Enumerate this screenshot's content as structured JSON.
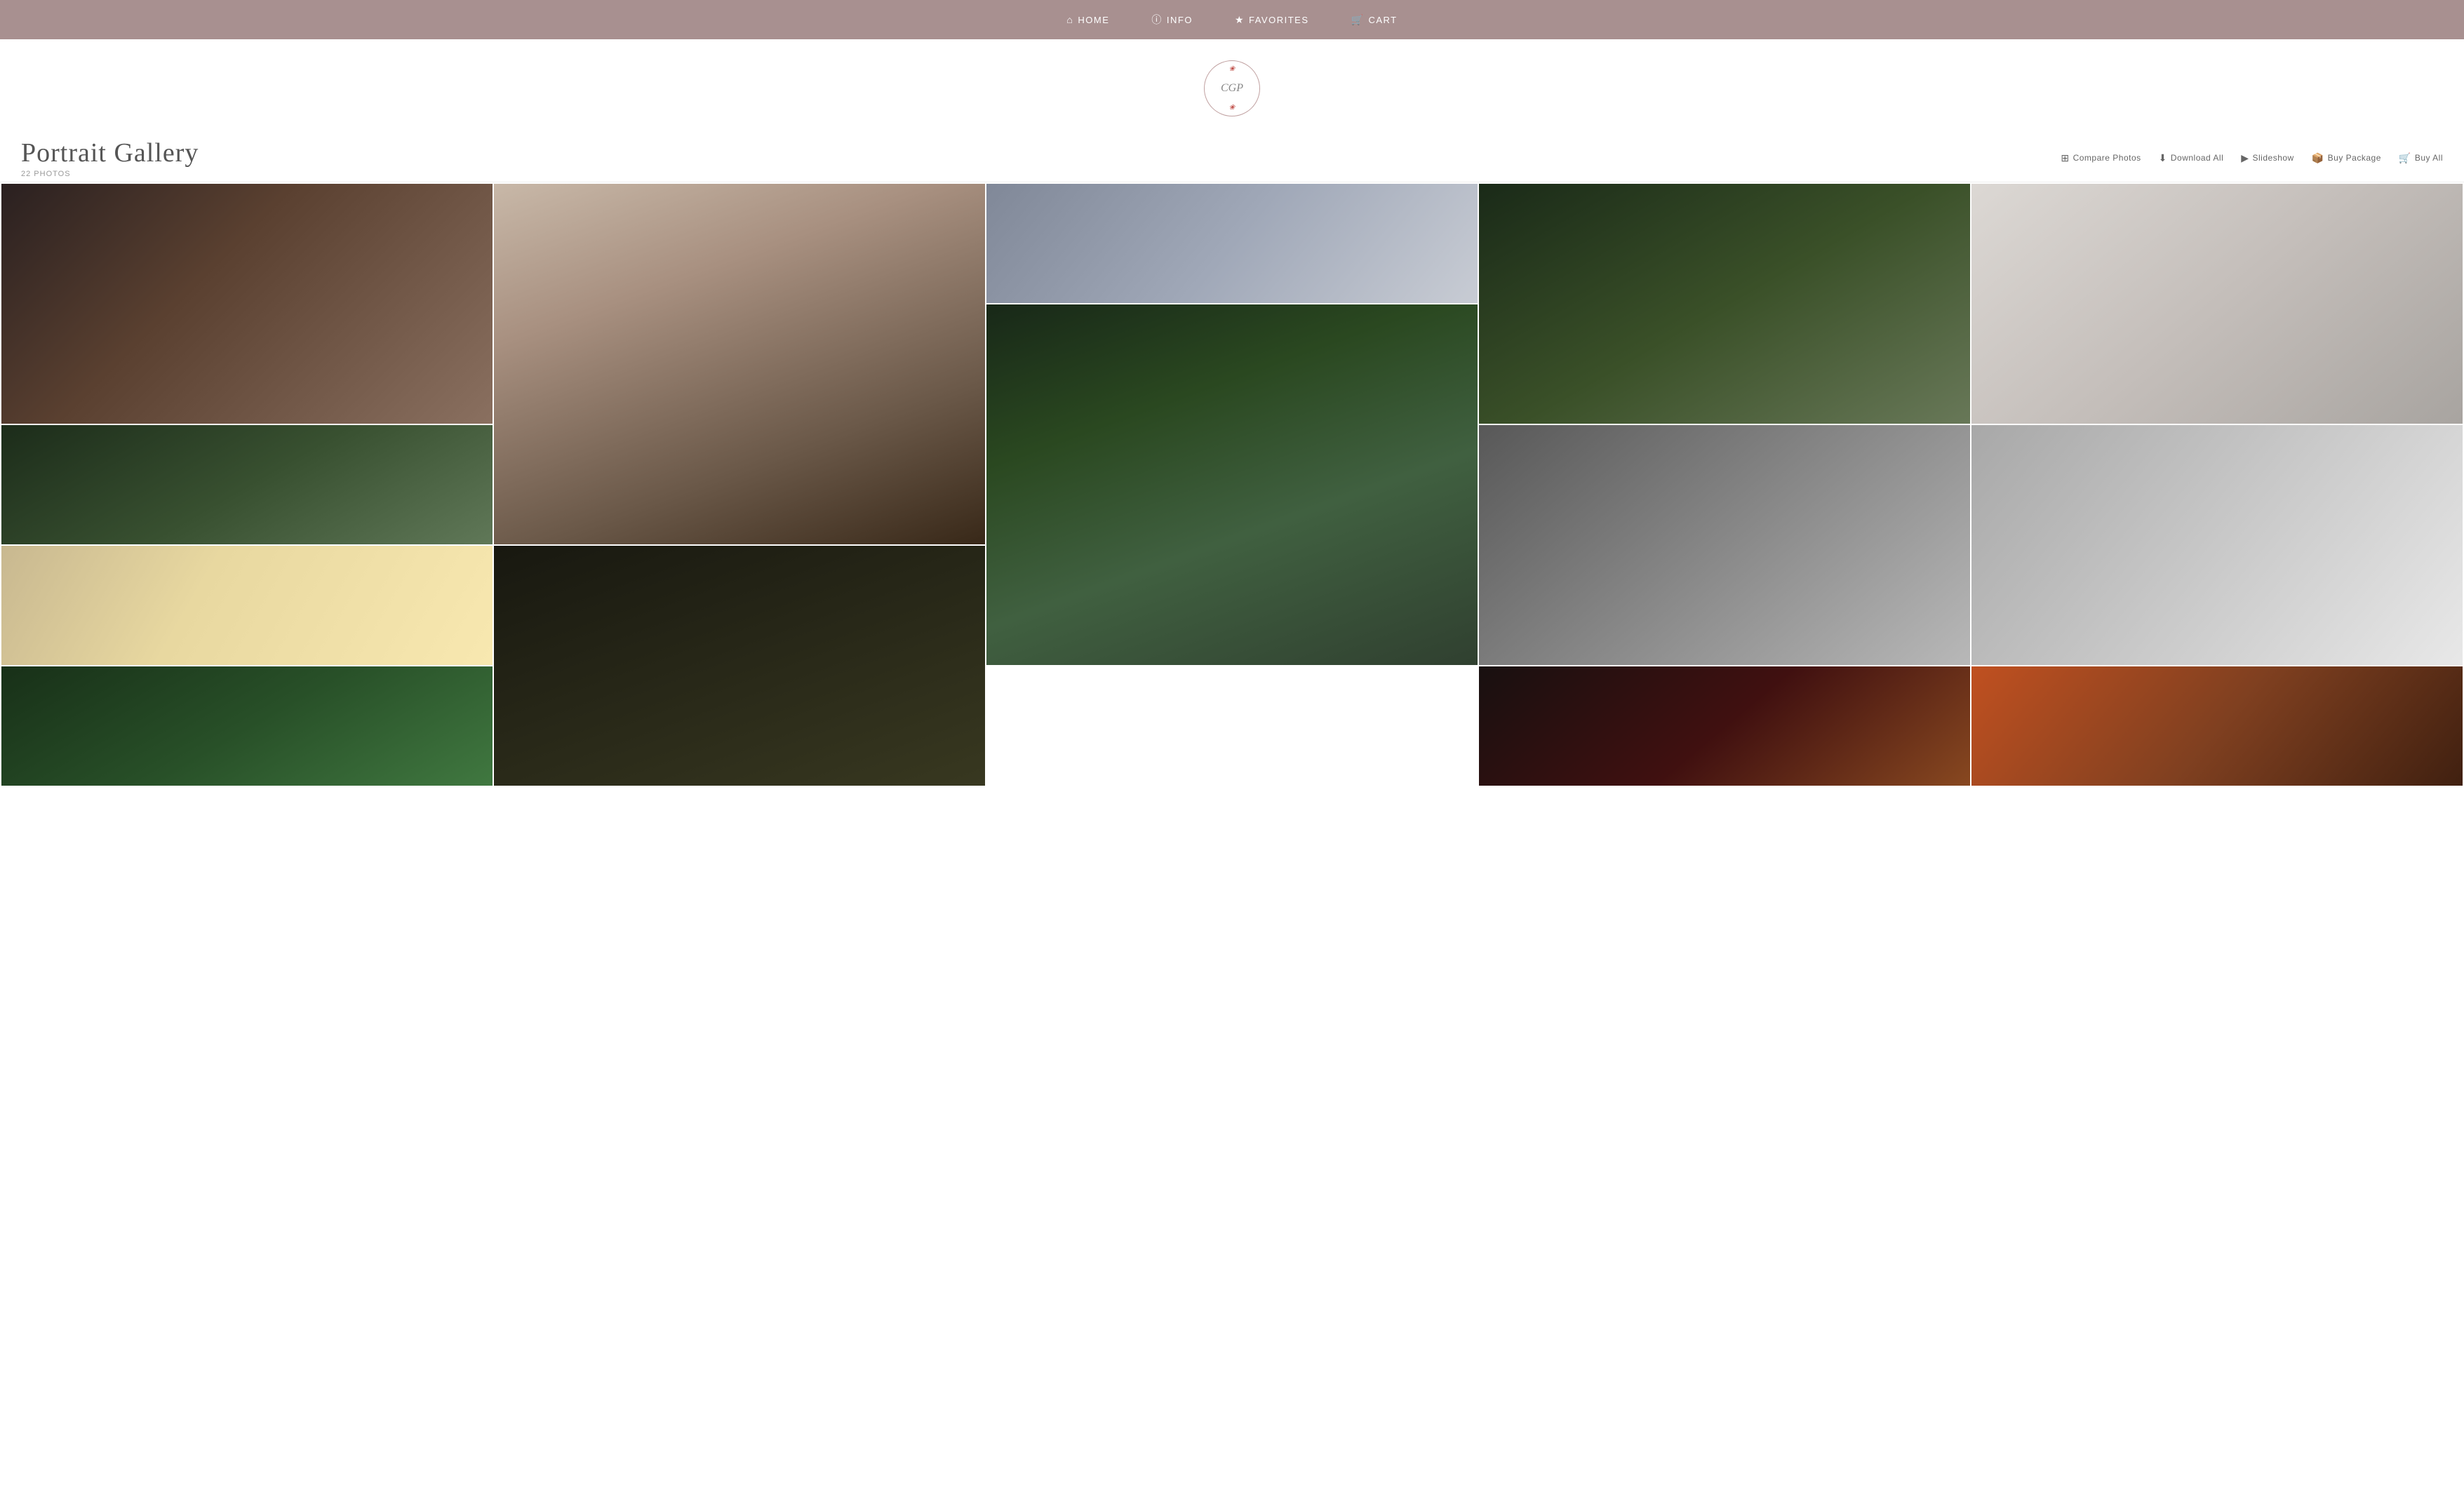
{
  "nav": {
    "items": [
      {
        "id": "home",
        "label": "HOME",
        "icon": "⌂"
      },
      {
        "id": "info",
        "label": "INFO",
        "icon": "ⓘ"
      },
      {
        "id": "favorites",
        "label": "FAVORITES",
        "icon": "★"
      },
      {
        "id": "cart",
        "label": "CART",
        "icon": "🛒"
      }
    ]
  },
  "logo": {
    "text": "CGP",
    "alt": "CGP Photography Logo"
  },
  "gallery": {
    "title": "Portrait Gallery",
    "photo_count": "22 PHOTOS",
    "actions": [
      {
        "id": "compare",
        "label": "Compare Photos",
        "icon": "⊞"
      },
      {
        "id": "download",
        "label": "Download All",
        "icon": "⬇"
      },
      {
        "id": "slideshow",
        "label": "Slideshow",
        "icon": "▶"
      },
      {
        "id": "package",
        "label": "Buy Package",
        "icon": "📦"
      },
      {
        "id": "buyall",
        "label": "Buy All",
        "icon": "🛒"
      }
    ]
  },
  "colors": {
    "nav_bg": "#a89090",
    "nav_text": "#ffffff",
    "page_bg": "#ffffff"
  }
}
